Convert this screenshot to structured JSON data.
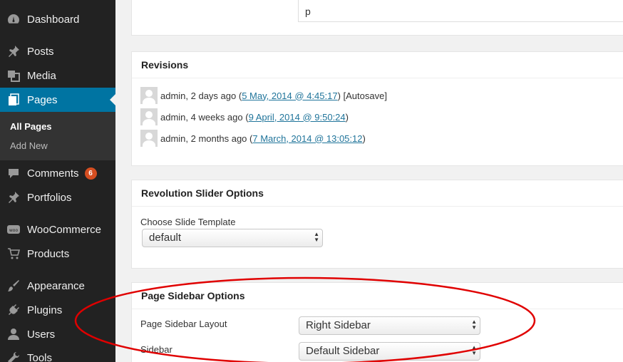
{
  "sidebar": {
    "items": [
      {
        "label": "Dashboard",
        "icon": "dashboard-icon"
      },
      {
        "label": "Posts",
        "icon": "pin-icon"
      },
      {
        "label": "Media",
        "icon": "media-icon"
      },
      {
        "label": "Pages",
        "icon": "pages-icon"
      },
      {
        "label": "Comments",
        "icon": "comment-icon",
        "badge": "6"
      },
      {
        "label": "Portfolios",
        "icon": "pin-icon"
      },
      {
        "label": "WooCommerce",
        "icon": "woo-icon"
      },
      {
        "label": "Products",
        "icon": "cart-icon"
      },
      {
        "label": "Appearance",
        "icon": "brush-icon"
      },
      {
        "label": "Plugins",
        "icon": "plug-icon"
      },
      {
        "label": "Users",
        "icon": "user-icon"
      },
      {
        "label": "Tools",
        "icon": "wrench-icon"
      }
    ],
    "submenu": [
      {
        "label": "All Pages"
      },
      {
        "label": "Add New"
      }
    ]
  },
  "top_box": {
    "text": "p"
  },
  "revisions": {
    "title": "Revisions",
    "rows": [
      {
        "text": "admin, 2 days ago (",
        "link": "5 May, 2014 @ 4:45:17",
        "suffix": ") [Autosave]"
      },
      {
        "text": "admin, 4 weeks ago (",
        "link": "9 April, 2014 @ 9:50:24",
        "suffix": ")"
      },
      {
        "text": "admin, 2 months ago (",
        "link": "7 March, 2014 @ 13:05:12",
        "suffix": ")"
      }
    ]
  },
  "revslider": {
    "title": "Revolution Slider Options",
    "label": "Choose Slide Template",
    "value": "default"
  },
  "page_sidebar": {
    "title": "Page Sidebar Options",
    "layout_label": "Page Sidebar Layout",
    "layout_value": "Right Sidebar",
    "sidebar_label": "Sidebar",
    "sidebar_value": "Default Sidebar"
  },
  "colors": {
    "sidebar_bg": "#222222",
    "active": "#0074a2",
    "link": "#21759b",
    "annotation": "#e00000",
    "badge": "#d54e21"
  }
}
